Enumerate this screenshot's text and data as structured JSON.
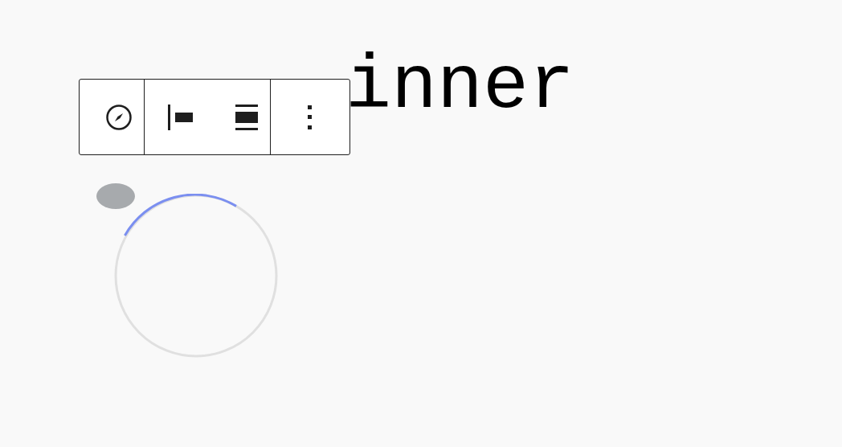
{
  "heading": {
    "text": "inner"
  },
  "toolbar": {
    "groups": [
      {
        "buttons": [
          {
            "kind": "compass"
          }
        ]
      },
      {
        "buttons": [
          {
            "kind": "align-left"
          },
          {
            "kind": "align-center"
          }
        ]
      },
      {
        "buttons": [
          {
            "kind": "more"
          }
        ]
      }
    ]
  },
  "spinner": {
    "kind": "spinner"
  }
}
